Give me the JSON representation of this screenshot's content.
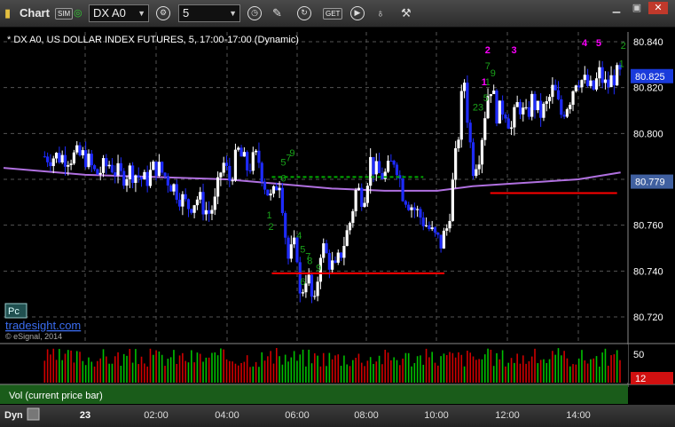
{
  "toolbar": {
    "app_title": "Chart",
    "sim_badge": "SIM",
    "symbol_value": "DX A0",
    "interval_value": "5",
    "icons": [
      "chart-icon",
      "link-dot-icon",
      "settings-icon",
      "clock-icon",
      "pencil-icon",
      "cycle-icon",
      "get-icon",
      "play-icon",
      "bulb-icon",
      "tools-icon"
    ],
    "get_label": "GET"
  },
  "chart_header": "* DX A0, US DOLLAR INDEX FUTURES, 5, 17:00-17:00 (Dynamic)",
  "watermark": {
    "site": "tradesight.com",
    "copyright": "© eSignal, 2014"
  },
  "pc_label": "Pc",
  "volume_panel": {
    "label": "Vol (current price bar)",
    "axis_label": "50",
    "current_value": "12"
  },
  "dyn_label": "Dyn",
  "colors": {
    "up": "#ffffff",
    "down": "#1e2bff",
    "ma": "#b070e0",
    "support": "#ff0000",
    "green_line": "#00aa00",
    "seq_green": "#1aa31a",
    "seq_magenta": "#ff00ff",
    "price_tag": "#1a3bdb",
    "ma_tag": "#4060a0",
    "vol_bg": "#1a5c1a"
  },
  "chart_data": {
    "type": "candlestick",
    "ylim": [
      80.71,
      80.845
    ],
    "yticks": [
      "80.840",
      "80.820",
      "80.800",
      "80.780",
      "80.760",
      "80.740",
      "80.720"
    ],
    "xticks": [
      "23",
      "02:00",
      "04:00",
      "06:00",
      "08:00",
      "10:00",
      "12:00",
      "14:00"
    ],
    "current_price": "80.825",
    "ma_value": "80.779",
    "ma_points": [
      [
        0,
        80.782
      ],
      [
        2,
        80.781
      ],
      [
        4,
        80.78
      ],
      [
        5.5,
        80.778
      ],
      [
        7,
        80.776
      ],
      [
        8.5,
        80.775
      ],
      [
        10,
        80.775
      ],
      [
        11,
        80.777
      ],
      [
        12,
        80.778
      ],
      [
        13,
        80.779
      ],
      [
        14,
        80.78
      ],
      [
        15.2,
        80.783
      ]
    ],
    "lines": [
      {
        "kind": "red",
        "y": 80.739,
        "x1": 5.3,
        "x2": 10.2
      },
      {
        "kind": "red",
        "y": 80.774,
        "x1": 11.5,
        "x2": 15.1
      },
      {
        "kind": "green",
        "y": 80.781,
        "x1": 5.3,
        "x2": 9.6
      }
    ],
    "green_labels": [
      {
        "t": "5",
        "x": 5.55,
        "y": 80.786
      },
      {
        "t": "7",
        "x": 5.7,
        "y": 80.788
      },
      {
        "t": "9",
        "x": 5.8,
        "y": 80.79
      },
      {
        "t": "6",
        "x": 5.55,
        "y": 80.779
      },
      {
        "t": "1",
        "x": 5.15,
        "y": 80.763
      },
      {
        "t": "2",
        "x": 5.2,
        "y": 80.758
      },
      {
        "t": "4",
        "x": 6.0,
        "y": 80.754
      },
      {
        "t": "5",
        "x": 6.1,
        "y": 80.748
      },
      {
        "t": "7",
        "x": 6.25,
        "y": 80.745
      },
      {
        "t": "8",
        "x": 6.3,
        "y": 80.743
      },
      {
        "t": "9",
        "x": 6.55,
        "y": 80.74
      },
      {
        "t": "6",
        "x": 6.1,
        "y": 80.734
      },
      {
        "t": "7",
        "x": 11.35,
        "y": 80.828
      },
      {
        "t": "9",
        "x": 11.5,
        "y": 80.825
      },
      {
        "t": "1",
        "x": 11.35,
        "y": 80.821
      },
      {
        "t": "5",
        "x": 11.3,
        "y": 80.814
      },
      {
        "t": "23",
        "x": 11.0,
        "y": 80.81
      },
      {
        "t": "2",
        "x": 15.2,
        "y": 80.837
      },
      {
        "t": "1",
        "x": 15.15,
        "y": 80.829
      }
    ],
    "magenta_labels": [
      {
        "t": "2",
        "x": 11.35,
        "y": 80.835
      },
      {
        "t": "3",
        "x": 12.1,
        "y": 80.835
      },
      {
        "t": "4",
        "x": 14.1,
        "y": 80.838
      },
      {
        "t": "5",
        "x": 14.5,
        "y": 80.838
      },
      {
        "t": "1",
        "x": 11.25,
        "y": 80.821
      }
    ],
    "price_path": [
      [
        0,
        80.79
      ],
      [
        0.3,
        80.782
      ],
      [
        0.7,
        80.787
      ],
      [
        1.0,
        80.781
      ],
      [
        1.3,
        80.784
      ],
      [
        1.7,
        80.779
      ],
      [
        2.0,
        80.786
      ],
      [
        2.3,
        80.781
      ],
      [
        2.6,
        80.775
      ],
      [
        2.9,
        80.768
      ],
      [
        3.2,
        80.772
      ],
      [
        3.5,
        80.765
      ],
      [
        3.7,
        80.77
      ],
      [
        3.9,
        80.788
      ],
      [
        4.1,
        80.78
      ],
      [
        4.35,
        80.792
      ],
      [
        4.6,
        80.785
      ],
      [
        4.9,
        80.79
      ],
      [
        5.1,
        80.778
      ],
      [
        5.3,
        80.77
      ],
      [
        5.5,
        80.782
      ],
      [
        5.6,
        80.77
      ],
      [
        5.75,
        80.745
      ],
      [
        6.0,
        80.752
      ],
      [
        6.1,
        80.728
      ],
      [
        6.3,
        80.74
      ],
      [
        6.5,
        80.722
      ],
      [
        6.7,
        80.752
      ],
      [
        6.9,
        80.745
      ],
      [
        7.1,
        80.74
      ],
      [
        7.3,
        80.75
      ],
      [
        7.5,
        80.76
      ],
      [
        7.7,
        80.776
      ],
      [
        7.9,
        80.772
      ],
      [
        8.1,
        80.788
      ],
      [
        8.3,
        80.782
      ],
      [
        8.55,
        80.782
      ],
      [
        8.8,
        80.79
      ],
      [
        9.0,
        80.775
      ],
      [
        9.2,
        80.77
      ],
      [
        9.45,
        80.765
      ],
      [
        9.7,
        80.76
      ],
      [
        9.9,
        80.755
      ],
      [
        10.1,
        80.752
      ],
      [
        10.3,
        80.76
      ],
      [
        10.45,
        80.78
      ],
      [
        10.6,
        80.8
      ],
      [
        10.75,
        80.826
      ],
      [
        10.85,
        80.808
      ],
      [
        11.0,
        80.785
      ],
      [
        11.2,
        80.792
      ],
      [
        11.4,
        80.815
      ],
      [
        11.5,
        80.822
      ],
      [
        11.7,
        80.808
      ],
      [
        11.9,
        80.812
      ],
      [
        12.1,
        80.802
      ],
      [
        12.3,
        80.814
      ],
      [
        12.5,
        80.806
      ],
      [
        12.7,
        80.815
      ],
      [
        12.9,
        80.808
      ],
      [
        13.1,
        80.812
      ],
      [
        13.3,
        80.82
      ],
      [
        13.5,
        80.808
      ],
      [
        13.75,
        80.815
      ],
      [
        13.95,
        80.825
      ],
      [
        14.2,
        80.822
      ],
      [
        14.4,
        80.818
      ],
      [
        14.6,
        80.826
      ],
      [
        14.8,
        80.82
      ],
      [
        15.0,
        80.825
      ],
      [
        15.2,
        80.825
      ]
    ]
  }
}
